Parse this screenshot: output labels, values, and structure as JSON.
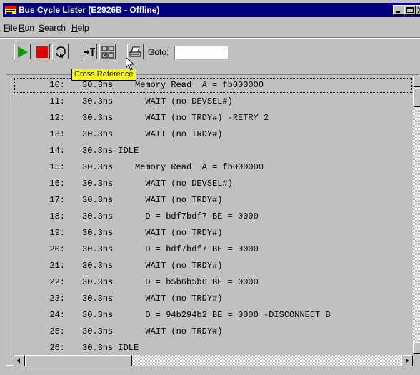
{
  "window": {
    "title": "Bus Cycle Lister (E2926B - Offline)",
    "controls": [
      "minimize-icon",
      "maximize-icon",
      "close-icon"
    ]
  },
  "menu": {
    "items": [
      {
        "label": "File",
        "mnemonic": "F"
      },
      {
        "label": "Run",
        "mnemonic": "R"
      },
      {
        "label": "Search",
        "mnemonic": "S"
      },
      {
        "label": "Help",
        "mnemonic": "H"
      }
    ]
  },
  "toolbar": {
    "buttons": [
      "play-icon",
      "stop-icon",
      "refresh-icon",
      "goto-trigger-icon",
      "cross-reference-icon",
      "print-icon"
    ],
    "goto_label": "Goto:",
    "goto_value": "",
    "tooltip": "Cross Reference"
  },
  "colors": {
    "titlebar": "#000080",
    "play": "#00a000",
    "stop": "#e00000",
    "tooltip_bg": "#ffff00"
  },
  "list": {
    "rows": [
      {
        "num": "10:",
        "time": "30.3ns",
        "event": "Memory Read  A = fb000000"
      },
      {
        "num": "11:",
        "time": "30.3ns",
        "event": "  WAIT (no DEVSEL#)"
      },
      {
        "num": "12:",
        "time": "30.3ns",
        "event": "  WAIT (no TRDY#) -RETRY 2"
      },
      {
        "num": "13:",
        "time": "30.3ns",
        "event": "  WAIT (no TRDY#)"
      },
      {
        "num": "14:",
        "time": "30.3ns IDLE",
        "event": ""
      },
      {
        "num": "15:",
        "time": "30.3ns",
        "event": "Memory Read  A = fb000000"
      },
      {
        "num": "16:",
        "time": "30.3ns",
        "event": "  WAIT (no DEVSEL#)"
      },
      {
        "num": "17:",
        "time": "30.3ns",
        "event": "  WAIT (no TRDY#)"
      },
      {
        "num": "18:",
        "time": "30.3ns",
        "event": "  D = bdf7bdf7 BE = 0000"
      },
      {
        "num": "19:",
        "time": "30.3ns",
        "event": "  WAIT (no TRDY#)"
      },
      {
        "num": "20:",
        "time": "30.3ns",
        "event": "  D = bdf7bdf7 BE = 0000"
      },
      {
        "num": "21:",
        "time": "30.3ns",
        "event": "  WAIT (no TRDY#)"
      },
      {
        "num": "22:",
        "time": "30.3ns",
        "event": "  D = b5b6b5b6 BE = 0000"
      },
      {
        "num": "23:",
        "time": "30.3ns",
        "event": "  WAIT (no TRDY#)"
      },
      {
        "num": "24:",
        "time": "30.3ns",
        "event": "  D = 94b294b2 BE = 0000 -DISCONNECT B"
      },
      {
        "num": "25:",
        "time": "30.3ns",
        "event": "  WAIT (no TRDY#)"
      },
      {
        "num": "26:",
        "time": "30.3ns IDLE",
        "event": ""
      }
    ]
  }
}
